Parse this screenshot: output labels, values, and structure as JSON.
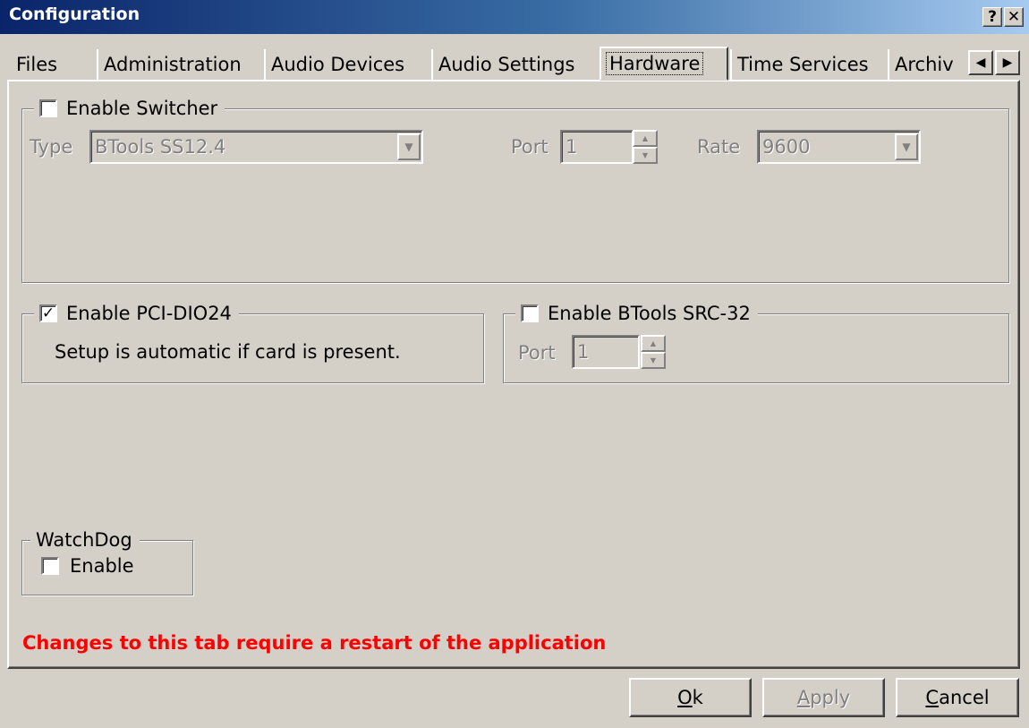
{
  "window": {
    "title": "Configuration",
    "help_label": "?",
    "close_label": "✕"
  },
  "tabs": [
    {
      "label": "Files"
    },
    {
      "label": "Administration"
    },
    {
      "label": "Audio Devices"
    },
    {
      "label": "Audio Settings"
    },
    {
      "label": "Hardware",
      "active": true
    },
    {
      "label": "Time Services"
    },
    {
      "label": "Archiv"
    }
  ],
  "tab_scroll": {
    "left": "◀",
    "right": "▶"
  },
  "switcher": {
    "label": "Enable Switcher",
    "checked": false,
    "type_label": "Type",
    "type_value": "BTools SS12.4",
    "port_label": "Port",
    "port_value": "1",
    "rate_label": "Rate",
    "rate_value": "9600"
  },
  "pci": {
    "label": "Enable PCI-DIO24",
    "checked": true,
    "check_mark": "✓",
    "note": "Setup is automatic if card is present."
  },
  "src": {
    "label": "Enable BTools SRC-32",
    "checked": false,
    "port_label": "Port",
    "port_value": "1"
  },
  "watchdog": {
    "title": "WatchDog",
    "enable_label": "Enable",
    "checked": false
  },
  "restart_message": "Changes to this tab require a restart of the application",
  "buttons": {
    "ok_mnemonic": "O",
    "ok_rest": "k",
    "apply_mnemonic": "A",
    "apply_rest": "pply",
    "cancel_mnemonic": "C",
    "cancel_rest": "ancel"
  },
  "colors": {
    "face": "#d4d0c8",
    "title_start": "#0a246a",
    "title_end": "#a6caf0",
    "warning": "#ff0000",
    "disabled_text": "#808080"
  }
}
